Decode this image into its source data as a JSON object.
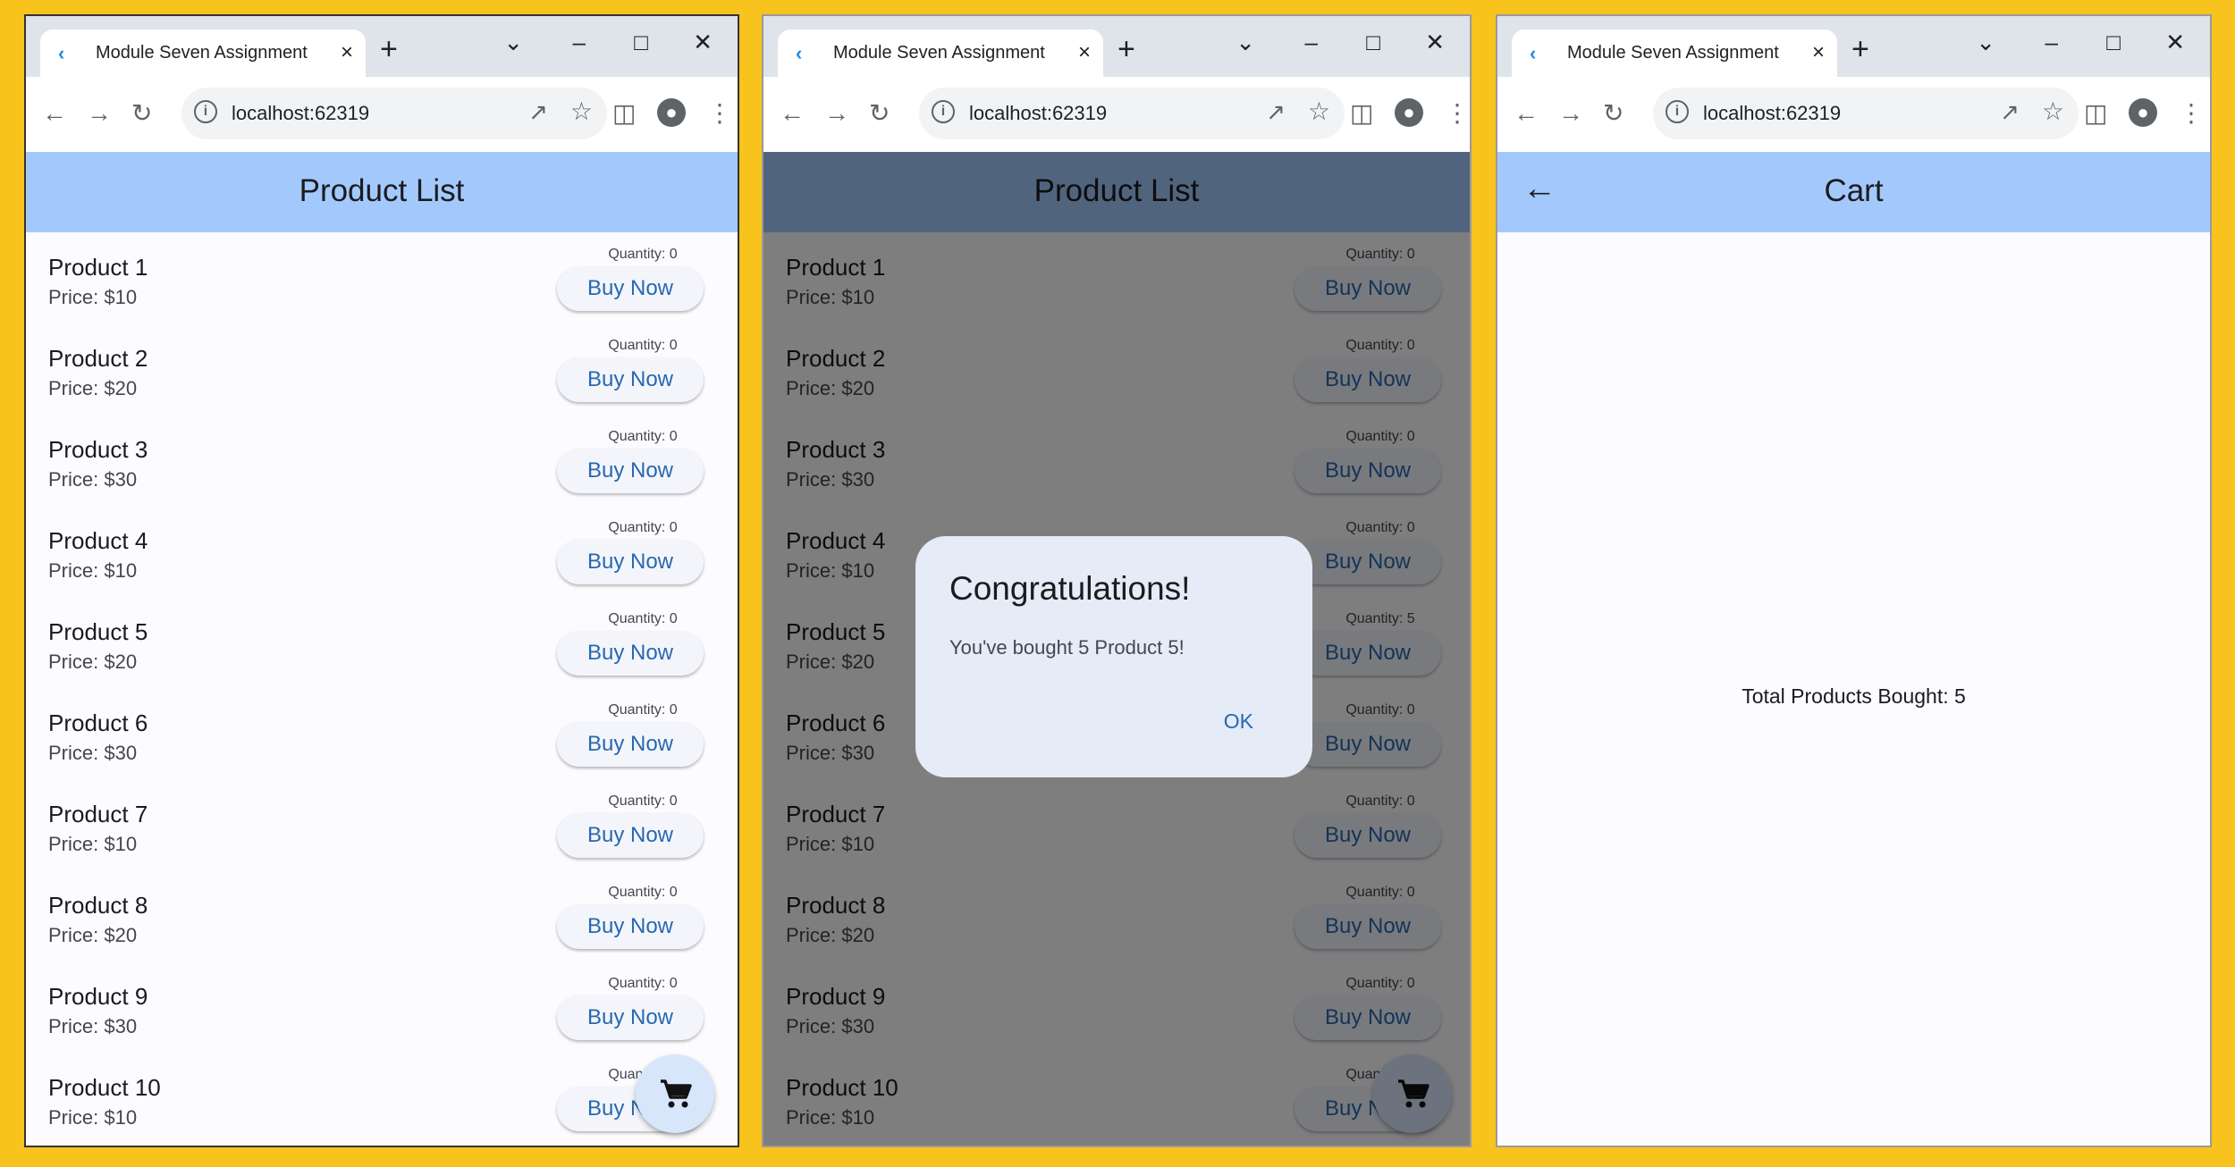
{
  "browser": {
    "tab_title": "Module Seven Assignment",
    "url": "localhost:62319"
  },
  "product_list": {
    "title": "Product List",
    "buy_label": "Buy Now",
    "products": [
      {
        "name": "Product 1",
        "price": "Price: $10",
        "quantity": "Quantity: 0"
      },
      {
        "name": "Product 2",
        "price": "Price: $20",
        "quantity": "Quantity: 0"
      },
      {
        "name": "Product 3",
        "price": "Price: $30",
        "quantity": "Quantity: 0"
      },
      {
        "name": "Product 4",
        "price": "Price: $10",
        "quantity": "Quantity: 0"
      },
      {
        "name": "Product 5",
        "price": "Price: $20",
        "quantity": "Quantity: 0"
      },
      {
        "name": "Product 6",
        "price": "Price: $30",
        "quantity": "Quantity: 0"
      },
      {
        "name": "Product 7",
        "price": "Price: $10",
        "quantity": "Quantity: 0"
      },
      {
        "name": "Product 8",
        "price": "Price: $20",
        "quantity": "Quantity: 0"
      },
      {
        "name": "Product 9",
        "price": "Price: $30",
        "quantity": "Quantity: 0"
      },
      {
        "name": "Product 10",
        "price": "Price: $10",
        "quantity": "Quantity: 0"
      }
    ]
  },
  "product_list_after_purchase": {
    "title": "Product List",
    "buy_label": "Buy Now",
    "products": [
      {
        "name": "Product 1",
        "price": "Price: $10",
        "quantity": "Quantity: 0"
      },
      {
        "name": "Product 2",
        "price": "Price: $20",
        "quantity": "Quantity: 0"
      },
      {
        "name": "Product 3",
        "price": "Price: $30",
        "quantity": "Quantity: 0"
      },
      {
        "name": "Product 4",
        "price": "Price: $10",
        "quantity": "Quantity: 0"
      },
      {
        "name": "Product 5",
        "price": "Price: $20",
        "quantity": "Quantity: 5"
      },
      {
        "name": "Product 6",
        "price": "Price: $30",
        "quantity": "Quantity: 0"
      },
      {
        "name": "Product 7",
        "price": "Price: $10",
        "quantity": "Quantity: 0"
      },
      {
        "name": "Product 8",
        "price": "Price: $20",
        "quantity": "Quantity: 0"
      },
      {
        "name": "Product 9",
        "price": "Price: $30",
        "quantity": "Quantity: 0"
      },
      {
        "name": "Product 10",
        "price": "Price: $10",
        "quantity": "Quantity: 0"
      }
    ]
  },
  "dialog": {
    "title": "Congratulations!",
    "message": "You've bought 5 Product 5!",
    "ok_label": "OK"
  },
  "cart": {
    "title": "Cart",
    "total_text": "Total Products Bought: 5"
  },
  "icons": {
    "fab": "shopping-cart-icon",
    "back": "arrow-back-icon"
  },
  "colors": {
    "background": "#F8C31C",
    "app_bar": "#A3C9FC",
    "accent": "#2768B0"
  }
}
